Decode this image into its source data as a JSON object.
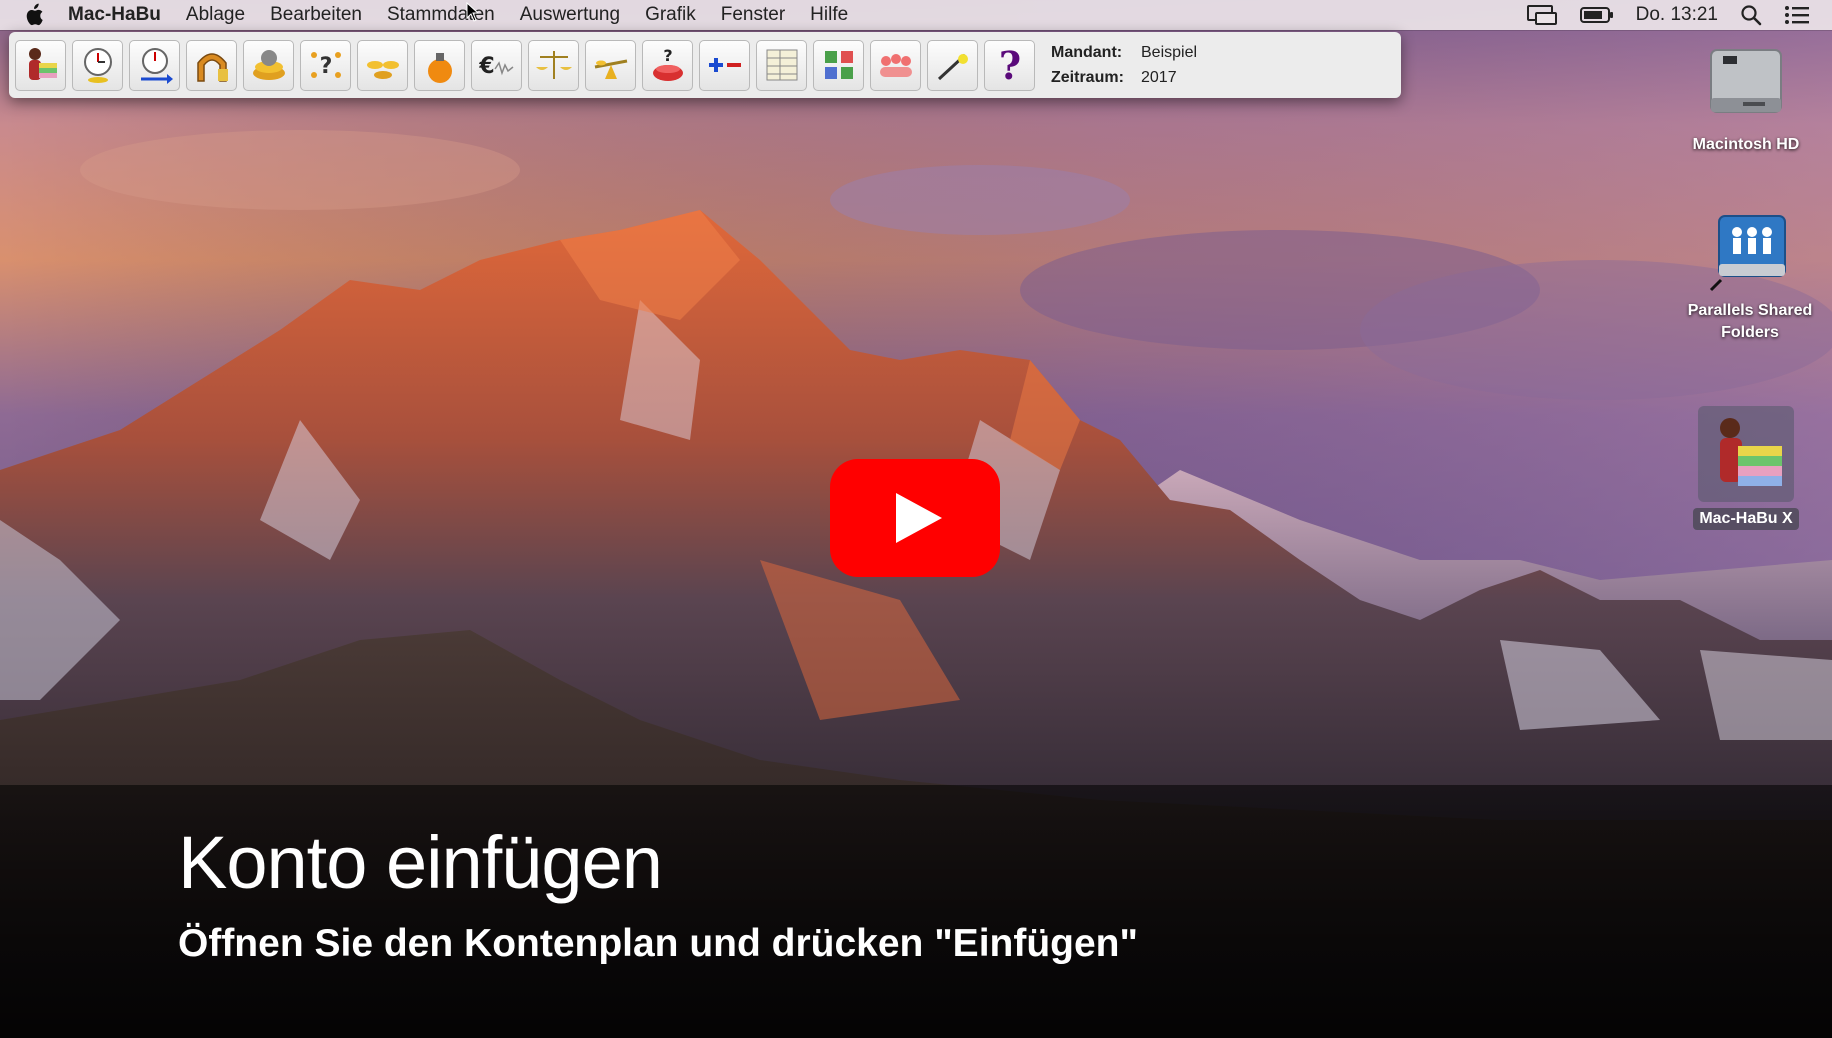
{
  "menubar": {
    "app_name": "Mac-HaBu",
    "items": [
      "Ablage",
      "Bearbeiten",
      "Stammdaten",
      "Auswertung",
      "Grafik",
      "Fenster",
      "Hilfe"
    ],
    "clock": "Do. 13:21"
  },
  "toolbar": {
    "icons": [
      "user-books-icon",
      "clock-add-icon",
      "clock-arrow-icon",
      "arch-icon",
      "coins-icon",
      "question-dots-icon",
      "coin-piles-icon",
      "money-bag-icon",
      "euro-wave-icon",
      "balance-scale-icon",
      "seesaw-icon",
      "pot-question-icon",
      "plus-minus-icon",
      "table-grid-icon",
      "puzzle-icon",
      "people-group-icon",
      "wand-icon",
      "help-icon"
    ],
    "mandant_label": "Mandant:",
    "mandant_value": "Beispiel",
    "zeitraum_label": "Zeitraum:",
    "zeitraum_value": "2017"
  },
  "desktop": {
    "icons": [
      {
        "label": "Macintosh HD"
      },
      {
        "label": "Parallels Shared Folders"
      },
      {
        "label": "Mac-HaBu X"
      }
    ]
  },
  "caption": {
    "title": "Konto einfügen",
    "subtitle": "Öffnen Sie den Kontenplan und drücken \"Einfügen\""
  },
  "colors": {
    "play_red": "#ff0000",
    "menubar_bg": "#ece4e8"
  }
}
